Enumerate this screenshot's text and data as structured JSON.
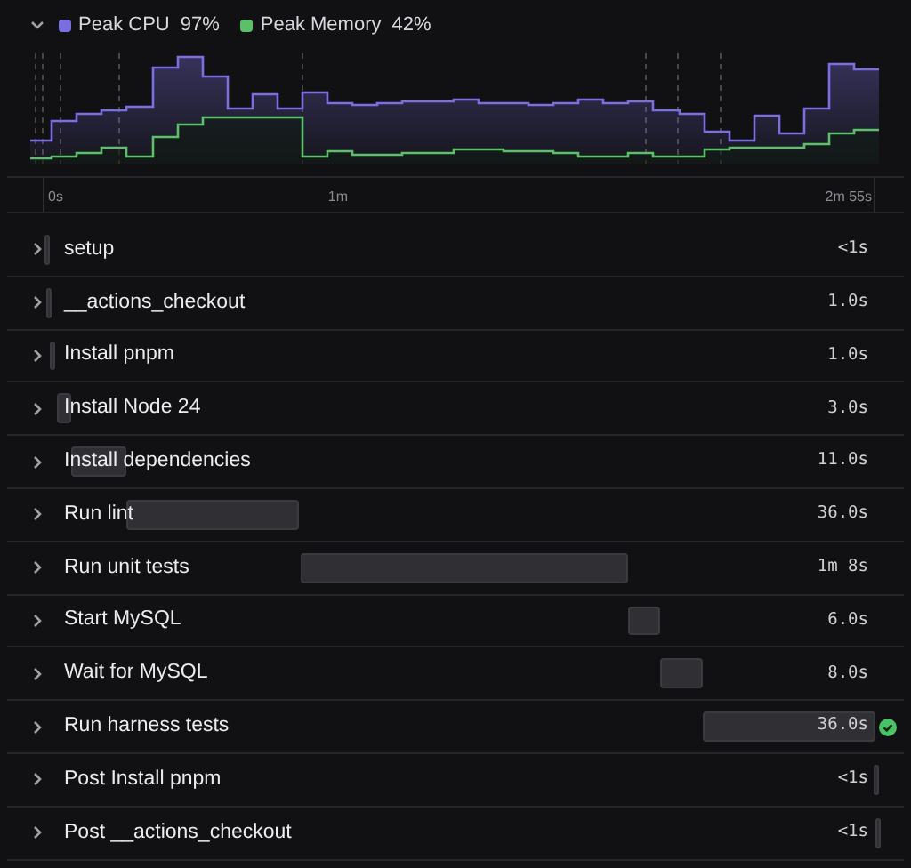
{
  "header": {
    "expanded": true,
    "legend": [
      {
        "label": "Peak CPU",
        "value": "97%",
        "color": "#7b6fe0"
      },
      {
        "label": "Peak Memory",
        "value": "42%",
        "color": "#5cbf6a"
      }
    ]
  },
  "axis": {
    "labels": [
      "0s",
      "1m",
      "2m 55s"
    ]
  },
  "steps": [
    {
      "name": "setup",
      "duration": "<1s",
      "expanded": false,
      "success": false
    },
    {
      "name": "__actions_checkout",
      "duration": "1.0s",
      "expanded": false,
      "success": false
    },
    {
      "name": "Install pnpm",
      "duration": "1.0s",
      "expanded": false,
      "success": false
    },
    {
      "name": "Install Node 24",
      "duration": "3.0s",
      "expanded": false,
      "success": false
    },
    {
      "name": "Install dependencies",
      "duration": "11.0s",
      "expanded": false,
      "success": false
    },
    {
      "name": "Run lint",
      "duration": "36.0s",
      "expanded": false,
      "success": false
    },
    {
      "name": "Run unit tests",
      "duration": "1m 8s",
      "expanded": false,
      "success": false
    },
    {
      "name": "Start MySQL",
      "duration": "6.0s",
      "expanded": false,
      "success": false
    },
    {
      "name": "Wait for MySQL",
      "duration": "8.0s",
      "expanded": false,
      "success": false
    },
    {
      "name": "Run harness tests",
      "duration": "36.0s",
      "expanded": false,
      "success": true
    },
    {
      "name": "Post Install pnpm",
      "duration": "<1s",
      "expanded": false,
      "success": false
    },
    {
      "name": "Post __actions_checkout",
      "duration": "<1s",
      "expanded": false,
      "success": false
    }
  ]
}
